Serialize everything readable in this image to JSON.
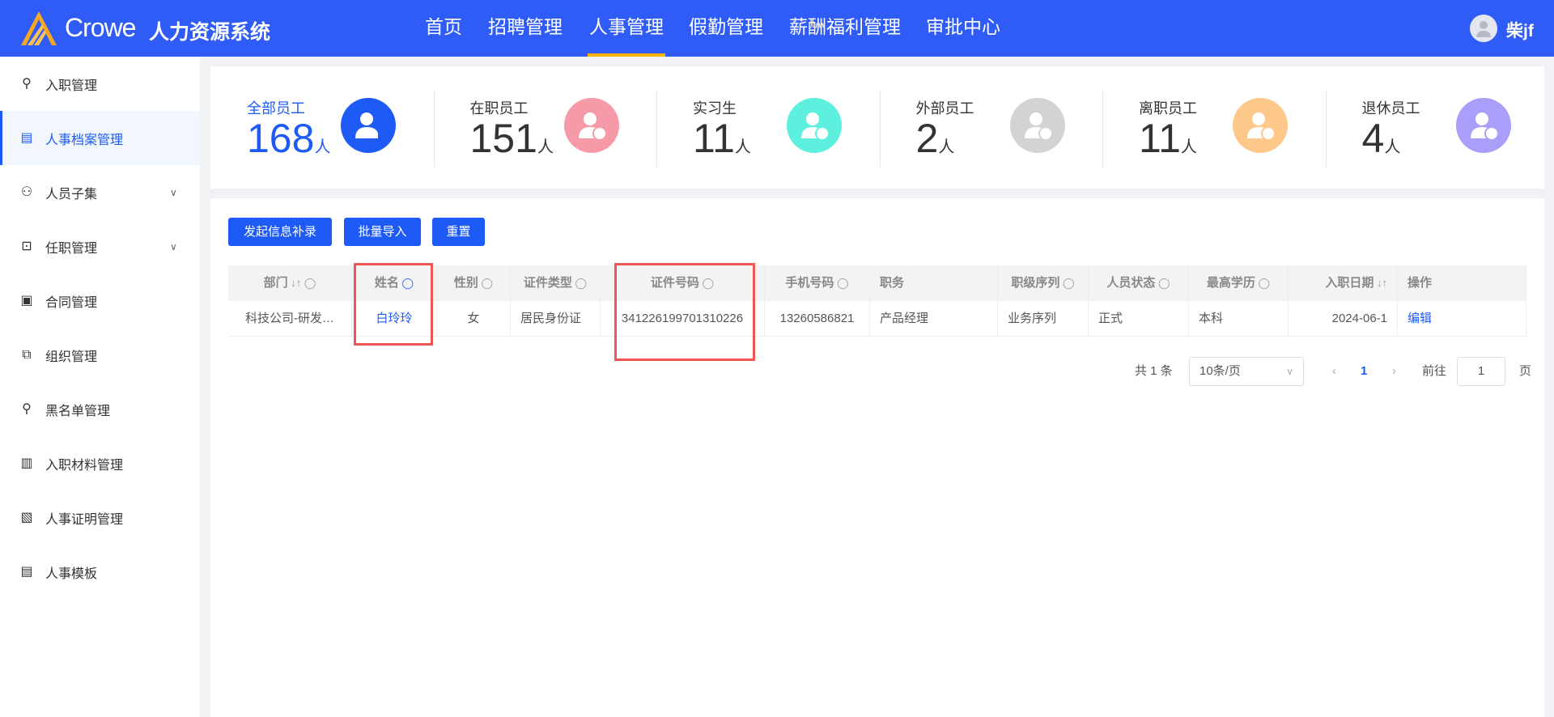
{
  "header": {
    "brand": "Crowe",
    "system_name": "人力资源系统",
    "nav": [
      "首页",
      "招聘管理",
      "人事管理",
      "假勤管理",
      "薪酬福利管理",
      "审批中心"
    ],
    "active_nav": "人事管理",
    "user": "柴jf",
    "accent": "#2f5cf6"
  },
  "sidebar": {
    "items": [
      {
        "label": "入职管理",
        "icon": "user-add-icon"
      },
      {
        "label": "人事档案管理",
        "icon": "document-icon",
        "active": true
      },
      {
        "label": "人员子集",
        "icon": "users-icon",
        "expandable": true
      },
      {
        "label": "任职管理",
        "icon": "briefcase-icon",
        "expandable": true
      },
      {
        "label": "合同管理",
        "icon": "contract-icon"
      },
      {
        "label": "组织管理",
        "icon": "org-icon"
      },
      {
        "label": "黑名单管理",
        "icon": "user-block-icon"
      },
      {
        "label": "入职材料管理",
        "icon": "books-icon"
      },
      {
        "label": "人事证明管理",
        "icon": "certificate-icon"
      },
      {
        "label": "人事模板",
        "icon": "template-icon"
      }
    ]
  },
  "stats": [
    {
      "label": "全部员工",
      "value": "168",
      "unit": "人",
      "color": "#1e5bf6",
      "highlight": true
    },
    {
      "label": "在职员工",
      "value": "151",
      "unit": "人",
      "color": "#f79aa8"
    },
    {
      "label": "实习生",
      "value": "11",
      "unit": "人",
      "color": "#5ef0de"
    },
    {
      "label": "外部员工",
      "value": "2",
      "unit": "人",
      "color": "#d3d3d3"
    },
    {
      "label": "离职员工",
      "value": "11",
      "unit": "人",
      "color": "#fdc88a"
    },
    {
      "label": "退休员工",
      "value": "4",
      "unit": "人",
      "color": "#a99ffa"
    }
  ],
  "toolbar": {
    "buttons": [
      "发起信息补录",
      "批量导入",
      "重置"
    ]
  },
  "table": {
    "columns": [
      "部门",
      "姓名",
      "性别",
      "证件类型",
      "证件号码",
      "手机号码",
      "职务",
      "职级序列",
      "人员状态",
      "最高学历",
      "入职日期",
      "操作"
    ],
    "rows": [
      [
        "科技公司-研发…",
        "白玲玲",
        "女",
        "居民身份证",
        "341226199701310226",
        "13260586821",
        "产品经理",
        "业务序列",
        "正式",
        "本科",
        "2024-06-1",
        "编辑"
      ]
    ]
  },
  "pagination": {
    "total": "共 1 条",
    "page_size": "10条/页",
    "current_page": "1",
    "goto_label": "前往",
    "goto_value": "1",
    "page_suffix": "页"
  }
}
